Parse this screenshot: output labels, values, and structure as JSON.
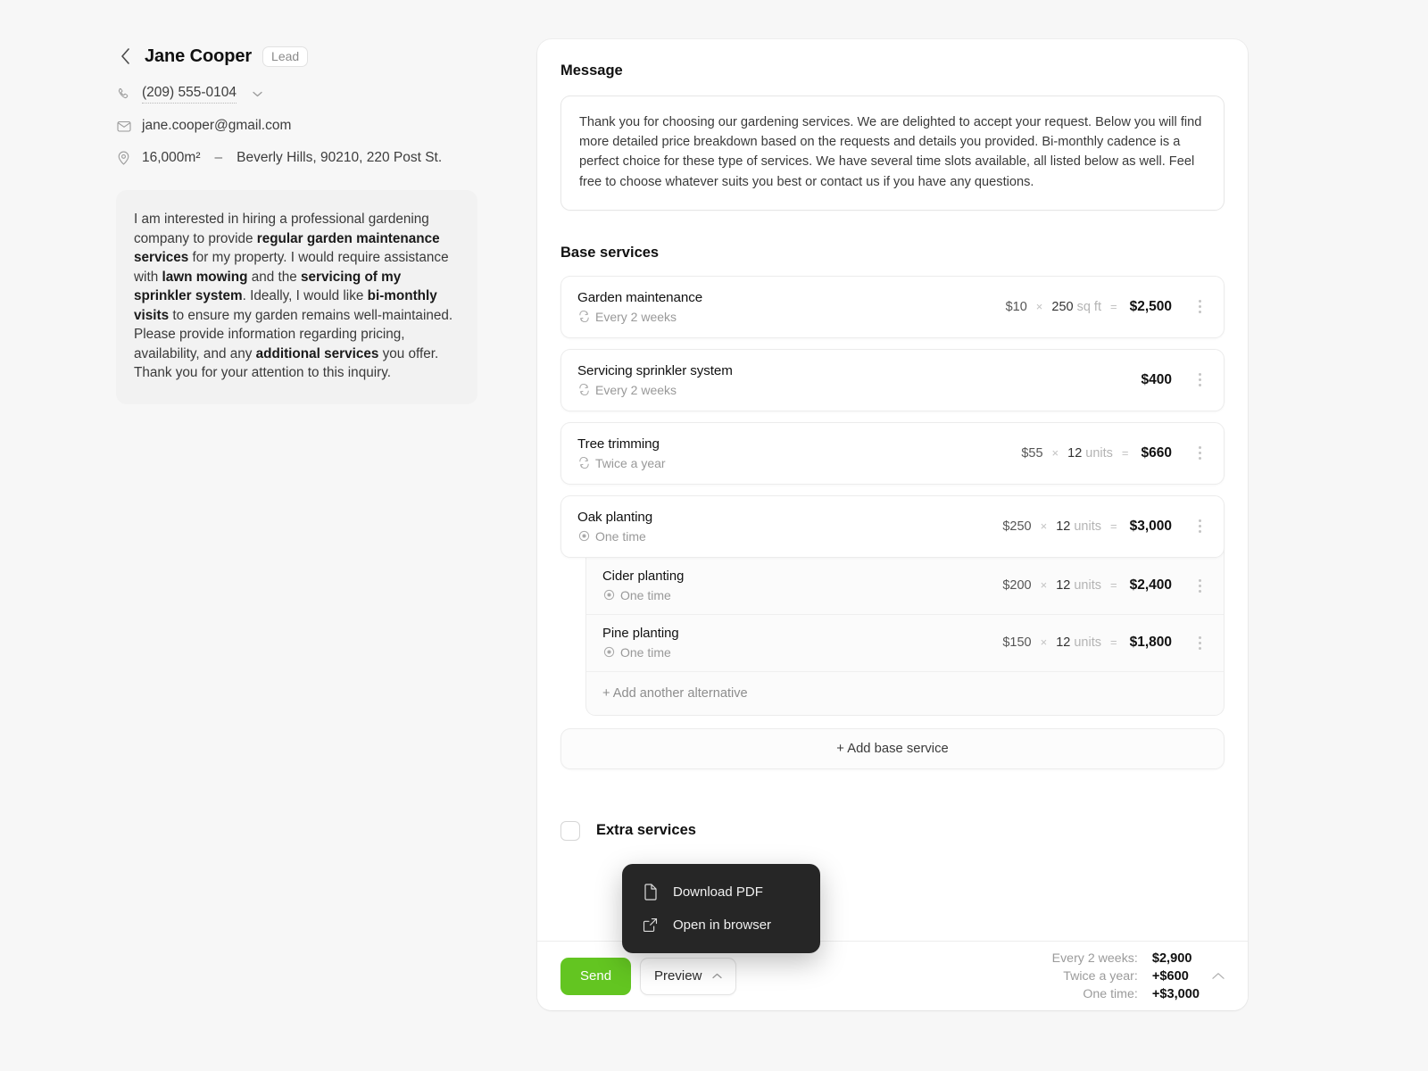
{
  "lead": {
    "back_icon": "chevron-left-icon",
    "name": "Jane Cooper",
    "badge": "Lead",
    "phone_icon": "phone-icon",
    "phone": "(209) 555-0104",
    "phone_chevron_icon": "chevron-down-icon",
    "email_icon": "envelope-icon",
    "email": "jane.cooper@gmail.com",
    "location_icon": "map-pin-icon",
    "area": "16,000m²",
    "separator": "–",
    "address": "Beverly Hills, 90210, 220 Post St.",
    "inquiry_html": "I am interested in hiring a professional gardening company to provide <b>regular garden maintenance services</b> for my property. I would require assistance with <b>lawn mowing</b> and the <b>servicing of my sprinkler system</b>. Ideally, I would like <b>bi-monthly visits</b> to ensure my garden remains well-maintained. Please provide information regarding pricing, availability, and any <b>additional services</b> you offer. Thank you for your attention to this inquiry."
  },
  "message": {
    "title": "Message",
    "body": "Thank you for choosing our gardening services. We are delighted to accept your request. Below you will find more detailed price breakdown based on the requests and details you provided. Bi-monthly cadence is a perfect choice for these type of services. We have several time slots available, all listed below as well. Feel free to choose whatever suits you best or contact us if you have any questions."
  },
  "base_services": {
    "title": "Base services",
    "add_label": "+ Add base service",
    "menu_icon": "kebab-menu-icon",
    "items": [
      {
        "name": "Garden maintenance",
        "cadence": "Every 2 weeks",
        "cadence_icon": "repeat-icon",
        "price": "$10",
        "mult": "×",
        "qty": "250",
        "unit": "sq ft",
        "eq": "=",
        "total": "$2,500",
        "has_calc": true
      },
      {
        "name": "Servicing sprinkler system",
        "cadence": "Every 2 weeks",
        "cadence_icon": "repeat-icon",
        "price": "",
        "mult": "",
        "qty": "",
        "unit": "",
        "eq": "",
        "total": "$400",
        "has_calc": false
      },
      {
        "name": "Tree trimming",
        "cadence": "Twice a year",
        "cadence_icon": "repeat-icon",
        "price": "$55",
        "mult": "×",
        "qty": "12",
        "unit": "units",
        "eq": "=",
        "total": "$660",
        "has_calc": true
      },
      {
        "name": "Oak planting",
        "cadence": "One time",
        "cadence_icon": "record-circle-icon",
        "price": "$250",
        "mult": "×",
        "qty": "12",
        "unit": "units",
        "eq": "=",
        "total": "$3,000",
        "has_calc": true
      }
    ],
    "alternatives": {
      "add_label": "+ Add another alternative",
      "items": [
        {
          "name": "Cider planting",
          "cadence": "One time",
          "cadence_icon": "record-circle-icon",
          "price": "$200",
          "mult": "×",
          "qty": "12",
          "unit": "units",
          "eq": "=",
          "total": "$2,400"
        },
        {
          "name": "Pine planting",
          "cadence": "One time",
          "cadence_icon": "record-circle-icon",
          "price": "$150",
          "mult": "×",
          "qty": "12",
          "unit": "units",
          "eq": "=",
          "total": "$1,800"
        }
      ]
    }
  },
  "extra_services": {
    "label": "Extra services",
    "checked": false
  },
  "context_menu": {
    "items": [
      {
        "label": "Download PDF",
        "icon": "file-icon"
      },
      {
        "label": "Open in browser",
        "icon": "external-link-icon"
      }
    ]
  },
  "footer": {
    "send_label": "Send",
    "preview_label": "Preview",
    "preview_chevron_icon": "chevron-up-icon",
    "collapse_icon": "chevron-up-icon",
    "totals": [
      {
        "label": "Every 2 weeks:",
        "value": "$2,900"
      },
      {
        "label": "Twice a year:",
        "value": "+$600"
      },
      {
        "label": "One time:",
        "value": "+$3,000"
      }
    ]
  },
  "colors": {
    "page_bg": "#f7f7f7",
    "send_green": "#63c521",
    "menu_dark": "#262626",
    "text_primary": "#111111",
    "text_muted": "#9b9b9b"
  }
}
